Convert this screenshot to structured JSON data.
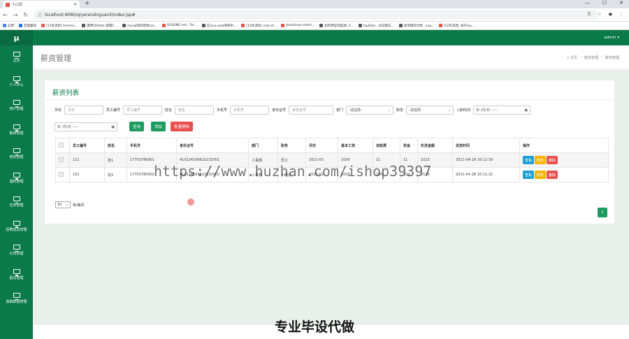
{
  "browser": {
    "tab_title": "人口页",
    "url": "localhost:8080/qiyerenshiguanli/index.jsp#",
    "bookmarks": [
      "应用",
      "百度翻译",
      "(12条消息) freema...",
      "使用UEditor 踩雷C...",
      "mysql如何修改roo...",
      "README.md - Ter...",
      "在java web项目中...",
      "(12条消息) root of...",
      "bootstrap-select...",
      "如何用证到起源; 2...",
      "layDate - JS日期与...",
      "表单模块文档 - Lay...",
      "(12条消息) 关于lay..."
    ]
  },
  "sidebar": {
    "logo": "μ",
    "items": [
      {
        "label": "主页"
      },
      {
        "label": "个人中心"
      },
      {
        "label": "用户管理"
      },
      {
        "label": "薪资管理"
      },
      {
        "label": "培训管理"
      },
      {
        "label": "福利管理"
      },
      {
        "label": "任务管理"
      },
      {
        "label": "招聘信息管理"
      },
      {
        "label": "公告管理"
      },
      {
        "label": "留言管理"
      },
      {
        "label": "基础数据管理"
      }
    ]
  },
  "topbar": {
    "user": "admin ▾"
  },
  "header": {
    "title": "薪资管理",
    "breadcrumb": [
      "⌂ 主页",
      "›",
      "薪资管理",
      "›",
      "薪资管理"
    ]
  },
  "panel": {
    "title": "薪资列表"
  },
  "filters": {
    "month_label": "月份",
    "month_ph": "月份",
    "emp_no_label": "员工编号",
    "emp_no_ph": "员工编号",
    "name_label": "姓名",
    "name_ph": "姓名",
    "phone_label": "手机号",
    "phone_ph": "手机号",
    "id_label": "身份证号",
    "id_ph": "身份证号",
    "dept_label": "部门",
    "dept_value": "-请选择-",
    "post_label": "职务",
    "post_value": "-请选择-",
    "join_label": "入职时间",
    "join_value": "年 /月/日 --:--",
    "join_end_value": "年 /月/日 --:--",
    "search_btn": "查询",
    "add_btn": "添加",
    "batch_delete_btn": "批量删除"
  },
  "table": {
    "headers": [
      "员工编号",
      "姓名",
      "手机号",
      "身份证号",
      "部门",
      "职务",
      "月份",
      "基本工资",
      "加班费",
      "奖金",
      "实发金额",
      "发放时间",
      "操作"
    ],
    "rows": [
      [
        "111",
        "张1",
        "17703786901",
        "410224199610232001",
        "人事部",
        "员工",
        "2021-03",
        "1000",
        "11",
        "11",
        "1023",
        "2021-04-28 16:12:39"
      ],
      [
        "222",
        "张2",
        "17703786902",
        "410224199610232002",
        "人事部",
        "小组长",
        "2021-02",
        "1000",
        "100",
        "100",
        "1570",
        "2021-04-28 16:11:32"
      ]
    ],
    "op_view": "查看",
    "op_edit": "修改",
    "op_delete": "删除"
  },
  "pager": {
    "size": "10",
    "suffix": "条/每页",
    "page": "1"
  },
  "watermark": "https://www.huzhan.com/ishop39397",
  "banner": "专业毕设代做"
}
